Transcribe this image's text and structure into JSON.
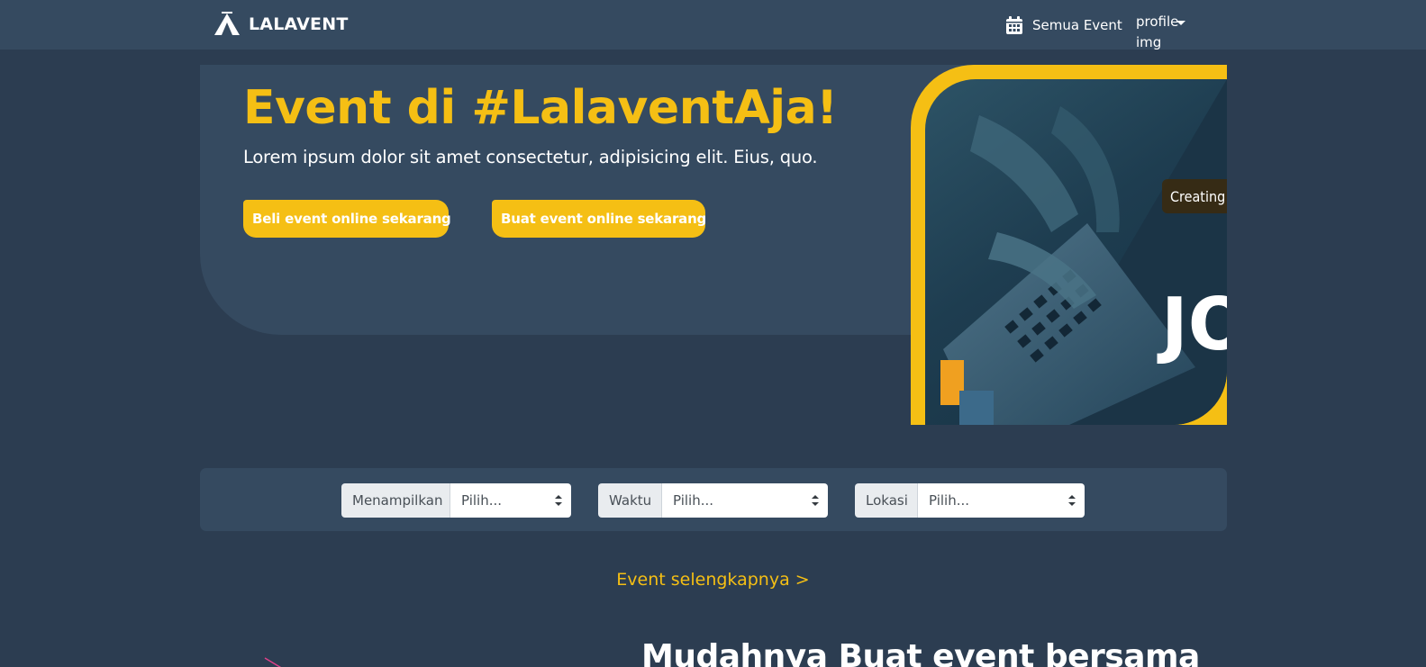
{
  "navbar": {
    "brand": "LALAVENT",
    "events_link": "Semua Event",
    "profile_alt": "profile-img"
  },
  "hero": {
    "title": "Event di #LalaventAja!",
    "subtitle": "Lorem ipsum dolor sit amet consectetur, adipisicing elit. Eius, quo.",
    "buy_button": "Beli event online sekarang",
    "create_button": "Buat event online sekarang",
    "image_text_top": "Creating a",
    "image_text_big": "JO"
  },
  "filters": [
    {
      "label": "Menampilkan",
      "value": "Pilih..."
    },
    {
      "label": "Waktu",
      "value": "Pilih..."
    },
    {
      "label": "Lokasi",
      "value": "Pilih..."
    }
  ],
  "more_link": "Event selengkapnya >",
  "section": {
    "title": "Mudahnya Buat event bersama"
  },
  "colors": {
    "background": "#2c3d51",
    "panel": "#354a60",
    "accent": "#f5bf14"
  }
}
